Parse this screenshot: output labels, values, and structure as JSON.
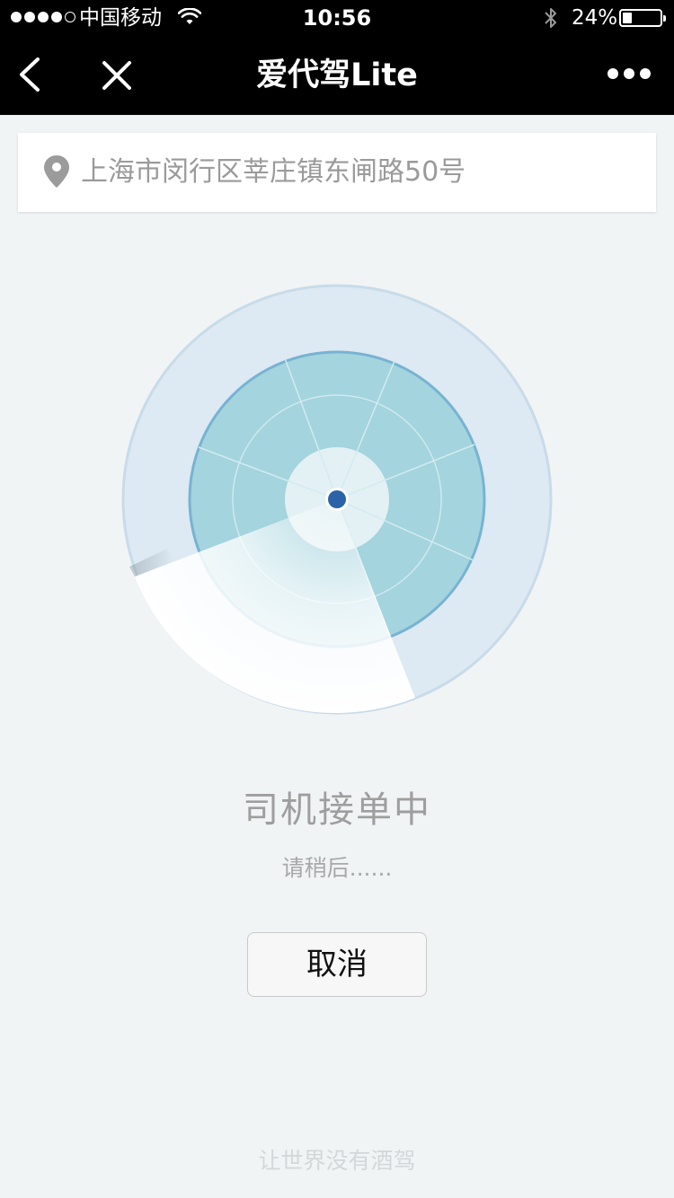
{
  "status_bar": {
    "carrier": "中国移动",
    "time": "10:56",
    "battery_percent_label": "24%",
    "battery_level": 0.24,
    "signal_bars_filled": 4,
    "signal_bars_total": 5
  },
  "nav": {
    "title": "爱代驾Lite",
    "back_icon": "chevron-left-icon",
    "close_icon": "close-icon",
    "more_icon": "more-dots-icon"
  },
  "address": {
    "icon": "location-pin-icon",
    "text": "上海市闵行区莘庄镇东闸路50号"
  },
  "radar": {
    "icon": "radar-scan-icon"
  },
  "order_status": {
    "title": "司机接单中",
    "subtitle": "请稍后......"
  },
  "cancel_label": "取消",
  "slogan": "让世界没有酒驾",
  "colors": {
    "topbar": "#000000",
    "background": "#f1f4f5",
    "radar_outer": "#dce9f3",
    "radar_inner": "#a3d4de",
    "radar_center_dot": "#2a64a6"
  }
}
